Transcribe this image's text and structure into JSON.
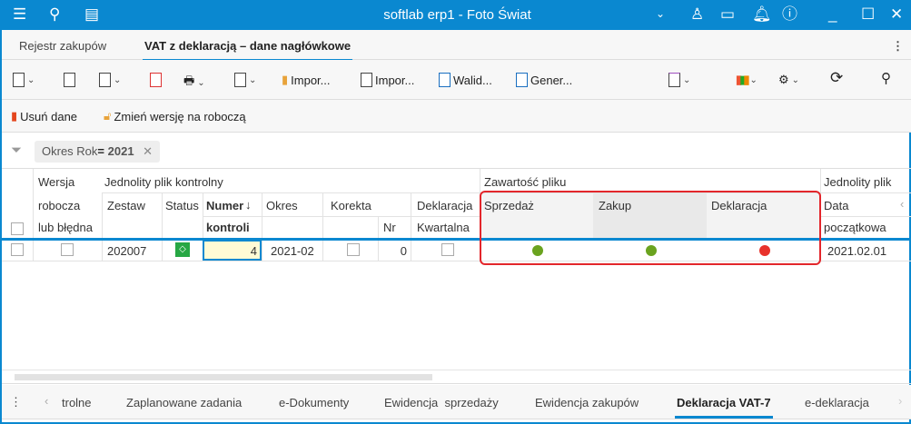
{
  "window": {
    "title": "softlab erp1 - Foto Świat"
  },
  "tabs": [
    {
      "label": "Rejestr zakupów"
    },
    {
      "label": "VAT z deklaracją – dane nagłówkowe"
    }
  ],
  "toolbar": {
    "import1": "Impor...",
    "import2": "Impor...",
    "validate": "Walid...",
    "generate": "Gener..."
  },
  "toolbar2": {
    "delete": "Usuń dane",
    "change_version": "Zmień wersję na roboczą"
  },
  "filter": {
    "field": "Okres Rok",
    "operator": "=",
    "value": "2021"
  },
  "grid": {
    "groups": {
      "jpk": "Jednolity plik kontrolny",
      "content": "Zawartość pliku",
      "jpk2": "Jednolity plik"
    },
    "headers": {
      "wersja1": "Wersja",
      "wersja2": "robocza",
      "wersja3": "lub błędna",
      "zestaw": "Zestaw",
      "status": "Status",
      "numer1": "Numer",
      "numer2": "kontroli",
      "okres": "Okres",
      "korekta": "Korekta",
      "nr": "Nr",
      "dekl1": "Deklaracja",
      "dekl2": "Kwartalna",
      "sprzedaz": "Sprzedaż",
      "zakup": "Zakup",
      "deklaracja": "Deklaracja",
      "data1": "Data",
      "data2": "początkowa"
    },
    "row": {
      "zestaw": "202007",
      "numer": "4",
      "okres": "2021-02",
      "nr": "0",
      "data": "2021.02.01",
      "sprzedaz_color": "#6aa31f",
      "zakup_color": "#6aa31f",
      "deklaracja_color": "#e8322b"
    }
  },
  "bottom_tabs": [
    {
      "label": "trolne"
    },
    {
      "label": "Zaplanowane zadania"
    },
    {
      "label": "e-Dokumenty"
    },
    {
      "label": "Ewidencja  sprzedaży"
    },
    {
      "label": "Ewidencja zakupów"
    },
    {
      "label": "Deklaracja VAT-7"
    },
    {
      "label": "e-deklaracja"
    }
  ]
}
